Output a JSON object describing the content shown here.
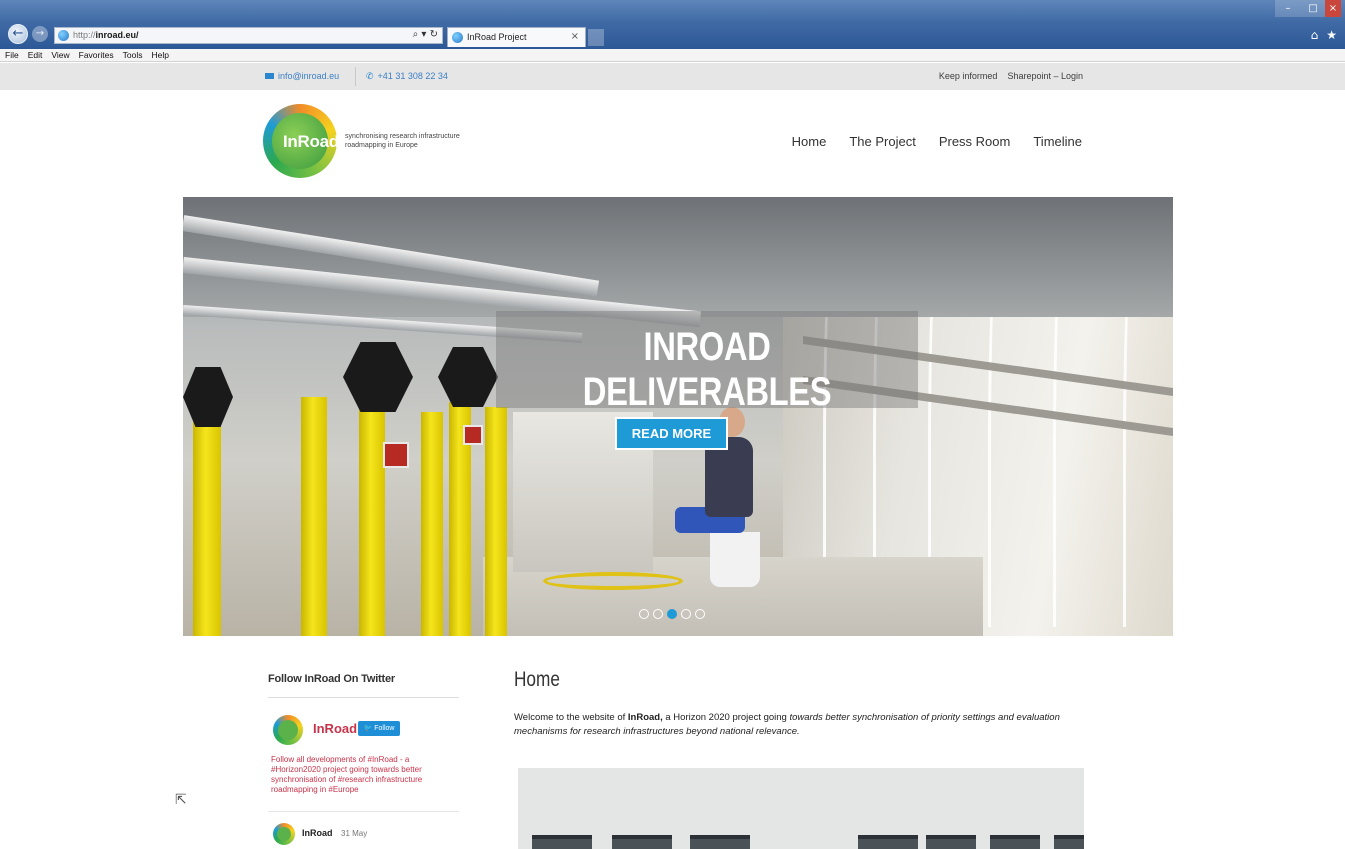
{
  "browser": {
    "url_proto": "http://",
    "url_host": "inroad.eu/",
    "tab_title": "InRoad Project",
    "tab_close": "×",
    "address_tools": "⌕ ▾ ↻",
    "menu": [
      "File",
      "Edit",
      "View",
      "Favorites",
      "Tools",
      "Help"
    ]
  },
  "topbar": {
    "email": "info@inroad.eu",
    "phone": "+41 31 308 22 34",
    "links": [
      "Keep informed",
      "Sharepoint – Login"
    ]
  },
  "header": {
    "logo_text": "InRoad",
    "tagline": "synchronising research infrastructure roadmapping in Europe",
    "nav": [
      "Home",
      "The Project",
      "Press Room",
      "Timeline"
    ]
  },
  "hero": {
    "title": "INROAD DELIVERABLES",
    "button": "READ MORE",
    "slides": 5,
    "active_slide": 3
  },
  "sidebar": {
    "title": "Follow InRoad On Twitter",
    "twitter_name": "InRoad",
    "follow_label": "Follow",
    "bio": "Follow all developments of #InRoad - a #Horizon2020 project going towards better synchronisation of #research infrastructure roadmapping in #Europe",
    "tweet_name": "InRoad",
    "tweet_date": "31 May"
  },
  "main": {
    "title": "Home",
    "intro_prefix": "Welcome to the website of ",
    "intro_bold": "InRoad,",
    "intro_middle": " a Horizon 2020 project going ",
    "intro_italic": "towards better synchronisation of priority settings and evaluation mechanisms for research infrastructures beyond national relevance."
  },
  "colors": {
    "accent": "#1e9ad6",
    "twitter_red": "#c8334a",
    "topbar_bg": "#e6e6e6"
  }
}
